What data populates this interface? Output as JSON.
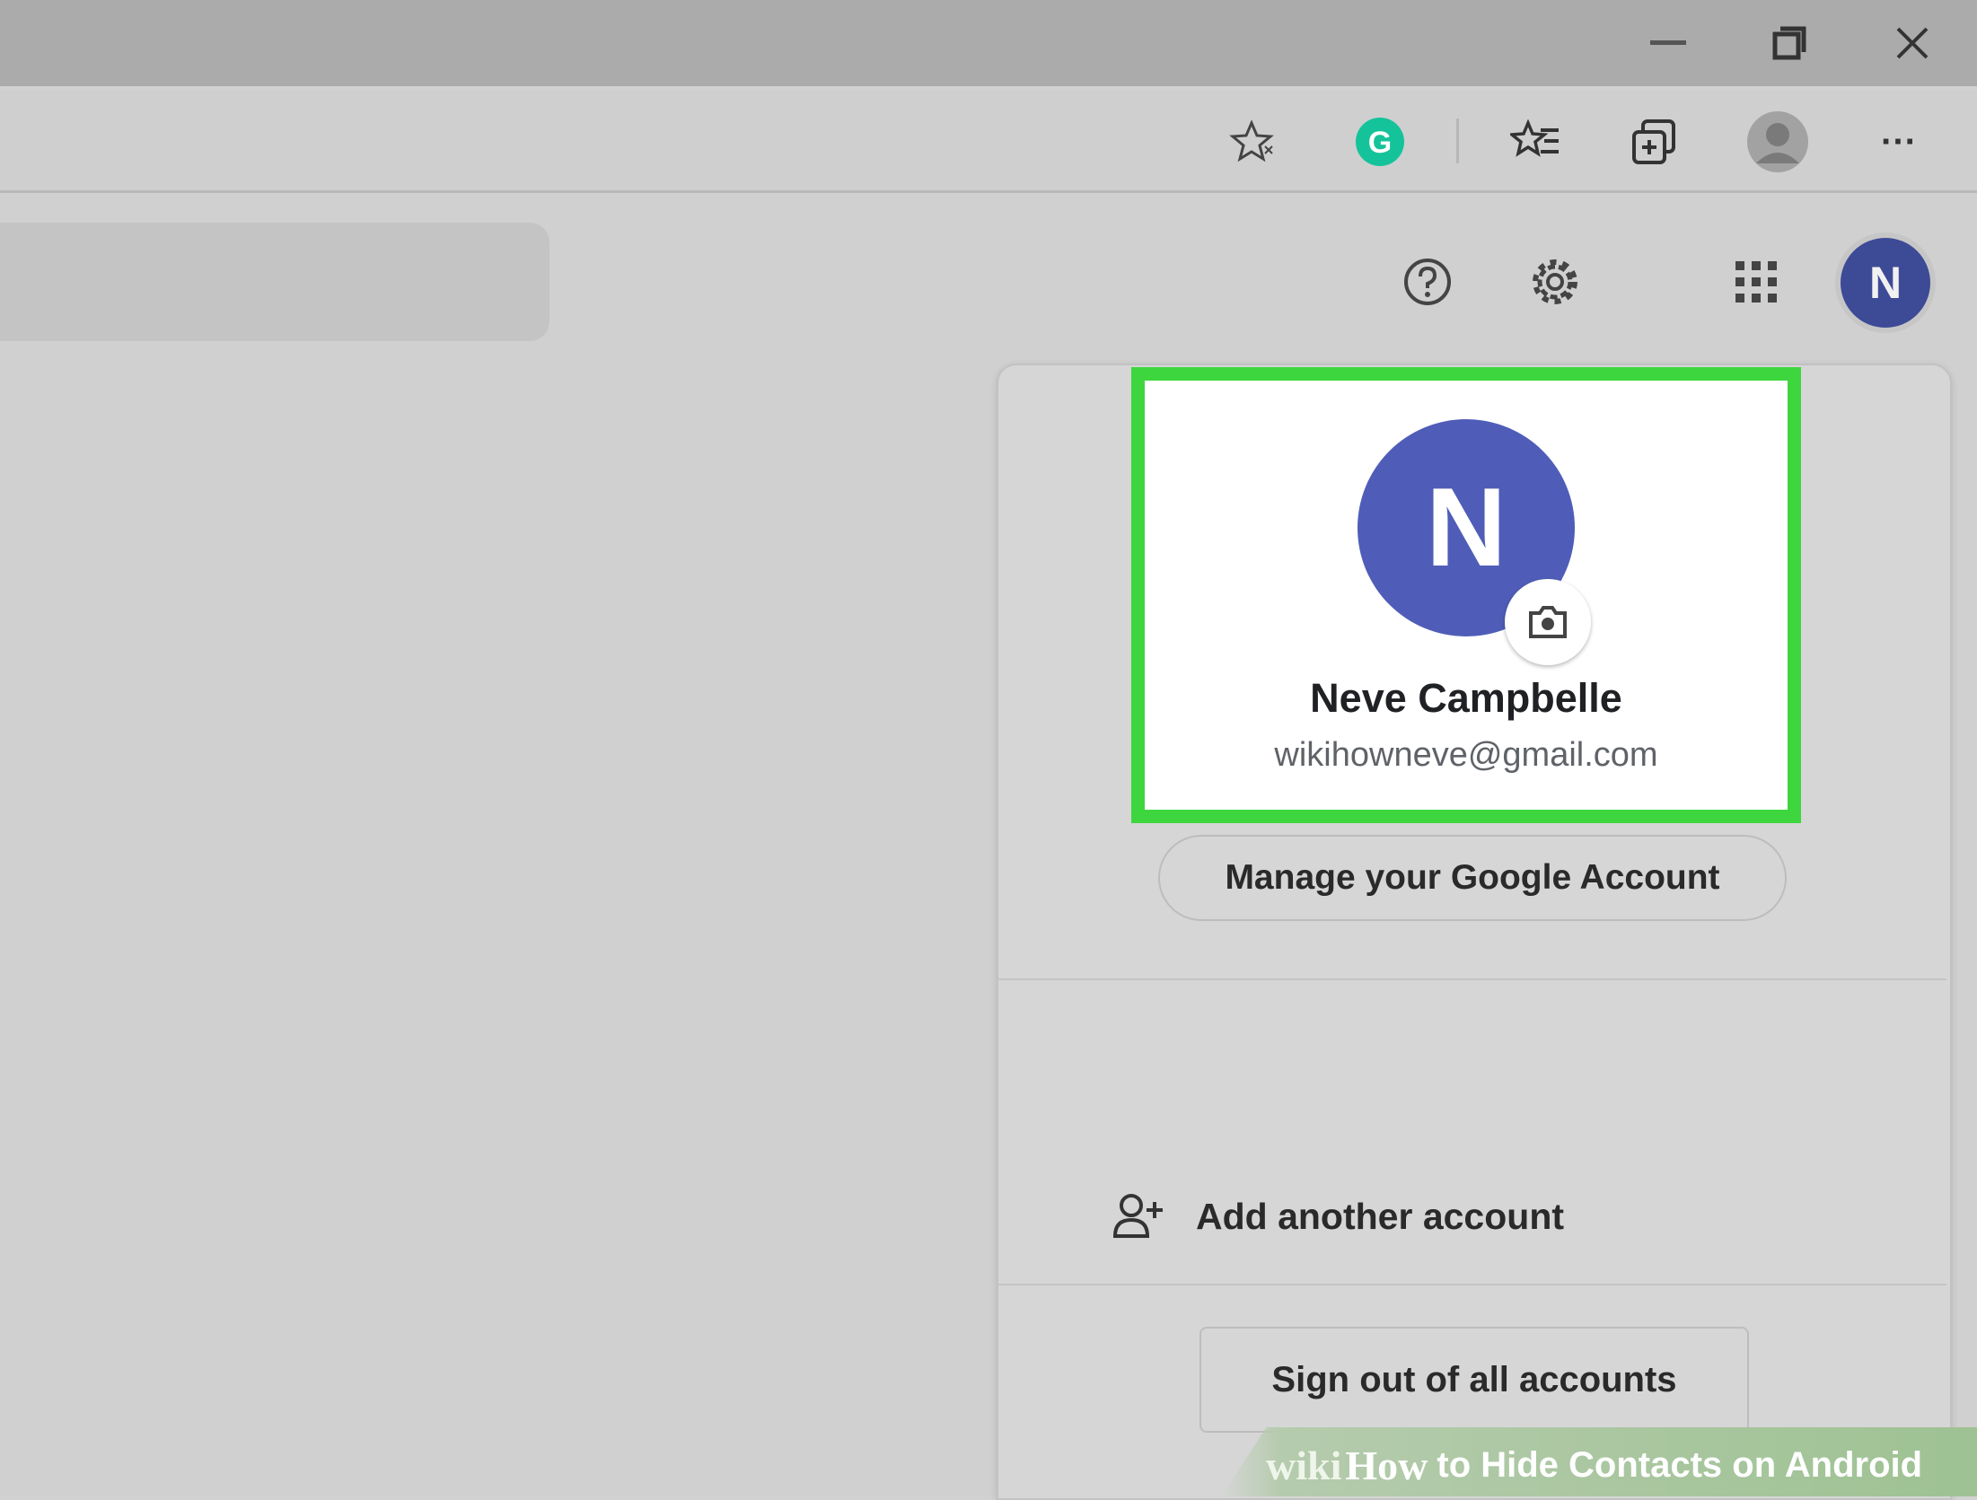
{
  "window": {
    "controls": [
      "minimize-icon",
      "restore-icon",
      "close-icon"
    ]
  },
  "toolbar": {
    "icons": [
      "star-icon",
      "grammarly-icon",
      "favorites-icon",
      "collections-icon",
      "profile-icon",
      "more-icon"
    ],
    "grammarly_letter": "G",
    "more_label": "···"
  },
  "header": {
    "icons": [
      "help-icon",
      "settings-icon",
      "apps-grid-icon"
    ],
    "avatar_letter": "N"
  },
  "account_panel": {
    "avatar_letter": "N",
    "name": "Neve Campbelle",
    "email": "wikihowneve@gmail.com",
    "manage_button": "Manage your Google Account",
    "add_account": "Add another account",
    "sign_out": "Sign out of all accounts"
  },
  "watermark": {
    "wiki": "wiki",
    "how": "How",
    "title": "to Hide Contacts on Android"
  },
  "colors": {
    "avatar": "#4f5db8",
    "highlight": "#3ed63e",
    "header_avatar": "#3d4a96",
    "grammarly": "#15c39a"
  }
}
